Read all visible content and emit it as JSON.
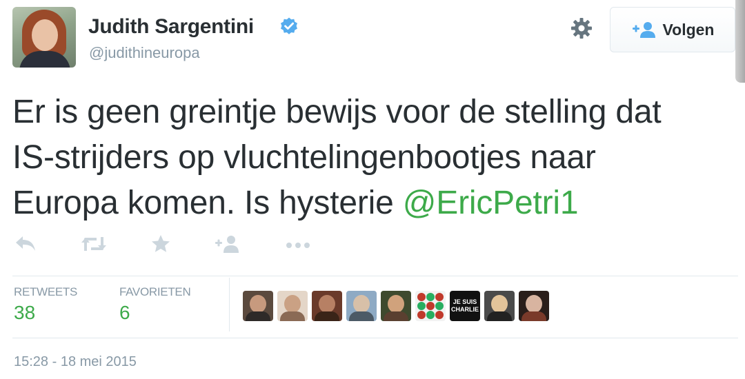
{
  "author": {
    "name": "Judith Sargentini",
    "handle": "@judithineuropa",
    "verified": true
  },
  "header": {
    "follow_label": "Volgen",
    "settings_icon": "gear-icon",
    "follow_icon": "add-user-icon"
  },
  "tweet": {
    "line1": "Er is geen greintje bewijs voor de stelling dat",
    "line2": "IS-strijders op vluchtelingenbootjes naar",
    "line3_text": "Europa komen. Is hysterie ",
    "mention": "@EricPetri1"
  },
  "actions": [
    "reply-icon",
    "retweet-icon",
    "favorite-icon",
    "follow-icon",
    "more-icon"
  ],
  "stats": {
    "retweets_label": "RETWEETS",
    "retweets_count": "38",
    "favorites_label": "FAVORIETEN",
    "favorites_count": "6"
  },
  "faces_banner_text": [
    "JE SUIS",
    "CHARLIE"
  ],
  "timestamp": "15:28 - 18 mei 2015",
  "colors": {
    "accent_green": "#3daa4a",
    "muted": "#8899a6",
    "text": "#292f33",
    "verified_blue": "#55acee"
  }
}
